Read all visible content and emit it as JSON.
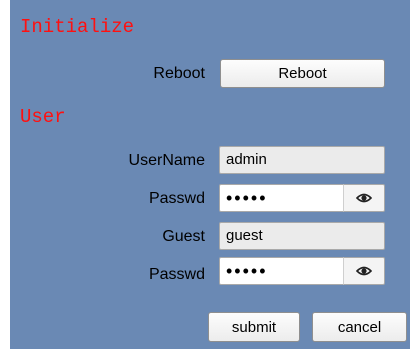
{
  "initialize": {
    "title": "Initialize",
    "reboot_label": "Reboot",
    "reboot_button": "Reboot"
  },
  "user": {
    "title": "User",
    "username_label": "UserName",
    "username_value": "admin",
    "passwd_label": "Passwd",
    "passwd_value": "•••••",
    "guest_label": "Guest",
    "guest_value": "guest",
    "guest_passwd_label": "Passwd",
    "guest_passwd_value": "•••••"
  },
  "actions": {
    "submit": "submit",
    "cancel": "cancel"
  },
  "icons": {
    "password_toggle": "eye-icon"
  },
  "colors": {
    "panel_background": "#6a89b4",
    "section_title": "#ff1010"
  }
}
